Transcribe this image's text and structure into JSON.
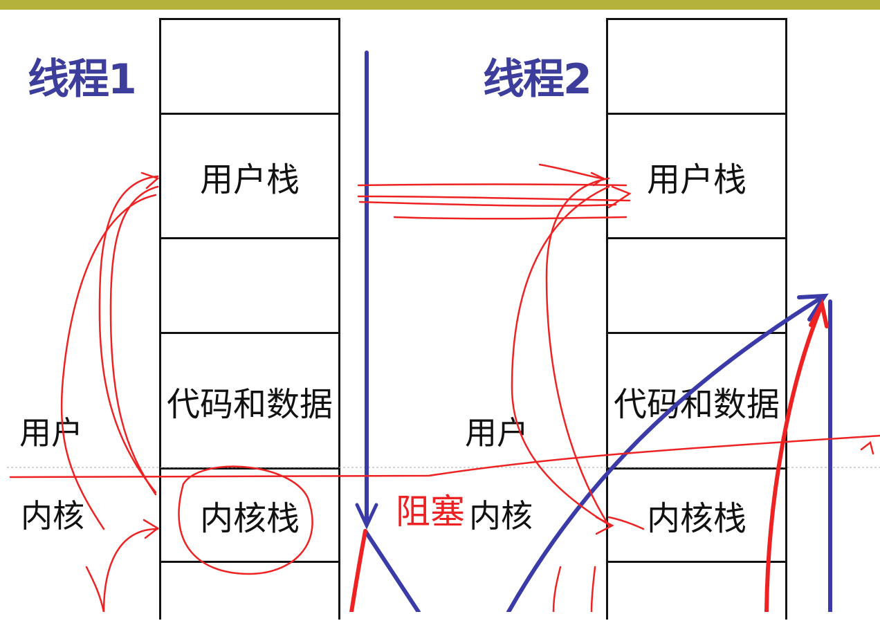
{
  "thread1": {
    "title": "线程1",
    "cells": [
      "",
      "用户栈",
      "",
      "代码和数据",
      "内核栈",
      ""
    ]
  },
  "thread2": {
    "title": "线程2",
    "cells": [
      "",
      "用户栈",
      "",
      "代码和数据",
      "内核栈",
      ""
    ]
  },
  "labels": {
    "user_left": "用户",
    "kernel_left": "内核",
    "user_mid": "用户",
    "kernel_mid": "内核",
    "blocked": "阻塞"
  },
  "colors": {
    "title": "#3d3d9c",
    "blue_arrow": "#3a3aa8",
    "red_annotation": "#ee2222",
    "top_bar": "#b5b23c"
  }
}
